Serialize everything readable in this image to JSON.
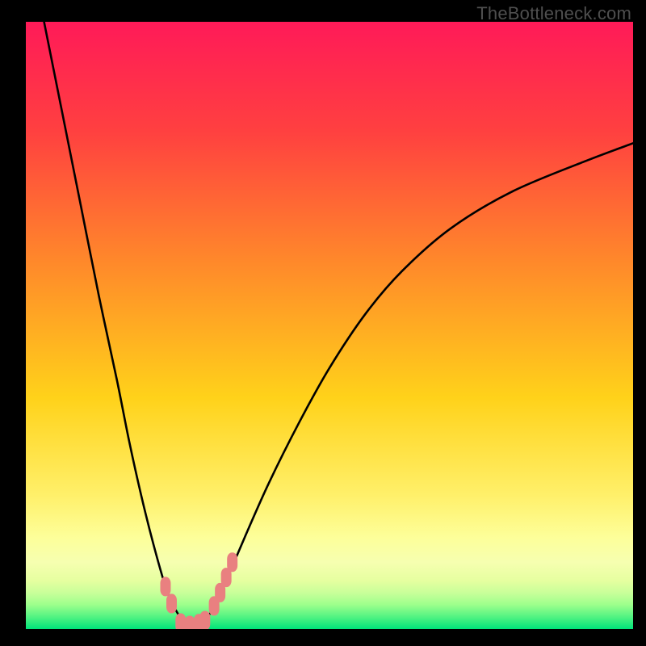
{
  "watermark": {
    "text": "TheBottleneck.com"
  },
  "colors": {
    "frame": "#000000",
    "curve": "#000000",
    "marker_fill": "#e98080",
    "marker_stroke": "#c85f5f",
    "gradient_top": "#ff1a58",
    "gradient_mid1": "#ff7a2a",
    "gradient_mid2": "#ffd21a",
    "gradient_mid3": "#fff79a",
    "gradient_low1": "#f6ffb0",
    "gradient_low2": "#c9ff9a",
    "gradient_bottom": "#00e47a"
  },
  "chart_data": {
    "type": "line",
    "title": "",
    "xlabel": "",
    "ylabel": "",
    "xlim": [
      0,
      100
    ],
    "ylim": [
      0,
      100
    ],
    "x": [
      3,
      6,
      9,
      12,
      15,
      17,
      19,
      21,
      23,
      24.5,
      26,
      27.5,
      29,
      31,
      33,
      36,
      40,
      45,
      50,
      56,
      62,
      70,
      80,
      92,
      100
    ],
    "y": [
      100,
      85,
      70,
      55,
      41,
      31,
      22,
      14,
      7,
      3.5,
      1.2,
      0.5,
      1.2,
      3.5,
      8,
      15,
      24,
      34,
      43,
      52,
      59,
      66,
      72,
      77,
      80
    ],
    "series": [
      {
        "name": "bottleneck-curve",
        "role": "line"
      }
    ],
    "markers": {
      "note": "highlighted points near curve minimum (salmon rounded markers)",
      "points": [
        {
          "x": 23.0,
          "y": 7.0
        },
        {
          "x": 24.0,
          "y": 4.2
        },
        {
          "x": 25.5,
          "y": 1.0
        },
        {
          "x": 27.0,
          "y": 0.6
        },
        {
          "x": 28.5,
          "y": 0.9
        },
        {
          "x": 29.5,
          "y": 1.4
        },
        {
          "x": 31.0,
          "y": 3.8
        },
        {
          "x": 32.0,
          "y": 6.0
        },
        {
          "x": 33.0,
          "y": 8.5
        },
        {
          "x": 34.0,
          "y": 11.0
        }
      ]
    },
    "grid": false,
    "legend": false
  }
}
